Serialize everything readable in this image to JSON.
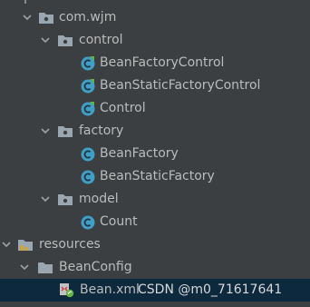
{
  "tree": {
    "items": [
      {
        "label": "com.wjm",
        "type": "package",
        "expanded": true,
        "icon": "package-folder-icon"
      },
      {
        "label": "control",
        "type": "package",
        "expanded": true,
        "icon": "package-folder-icon"
      },
      {
        "label": "BeanFactoryControl",
        "type": "class",
        "icon": "class-c-icon"
      },
      {
        "label": "BeanStaticFactoryControl",
        "type": "class",
        "icon": "class-c-icon"
      },
      {
        "label": "Control",
        "type": "class",
        "icon": "class-c-icon"
      },
      {
        "label": "factory",
        "type": "package",
        "expanded": true,
        "icon": "package-folder-icon"
      },
      {
        "label": "BeanFactory",
        "type": "class",
        "icon": "class-c-icon"
      },
      {
        "label": "BeanStaticFactory",
        "type": "class",
        "icon": "class-c-icon"
      },
      {
        "label": "model",
        "type": "package",
        "expanded": true,
        "icon": "package-folder-icon"
      },
      {
        "label": "Count",
        "type": "class",
        "icon": "class-c-icon"
      },
      {
        "label": "resources",
        "type": "resources-folder",
        "expanded": true,
        "icon": "resources-folder-icon"
      },
      {
        "label": "BeanConfig",
        "type": "folder",
        "expanded": true,
        "icon": "folder-icon"
      },
      {
        "label": "Bean.xml",
        "type": "xml-file",
        "selected": true,
        "icon": "spring-xml-icon"
      }
    ]
  },
  "watermark": {
    "text": "CSDN @m0_71617641"
  },
  "colors": {
    "background": "#3c3f41",
    "selection": "#0d293e",
    "text": "#bbbbbb",
    "class_icon": "#3f9fc6",
    "folder": "#9aa7b0"
  }
}
